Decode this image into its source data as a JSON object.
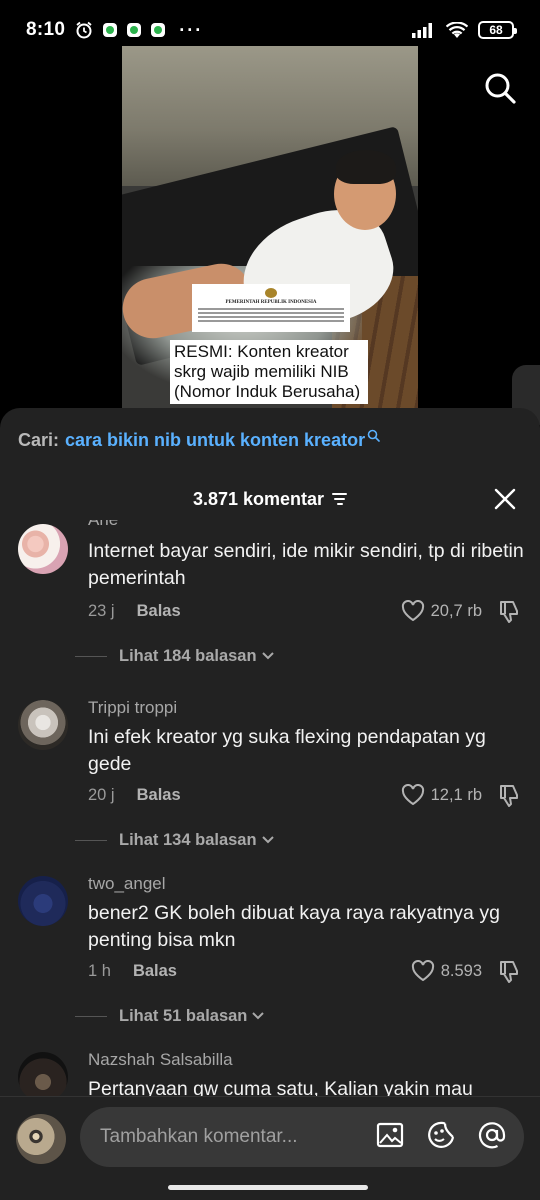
{
  "status_bar": {
    "time": "8:10",
    "battery": "68",
    "more": "···"
  },
  "video": {
    "doc_title": "PEMERINTAH REPUBLIK INDONESIA",
    "caption": "RESMI: Konten kreator skrg wajib memiliki NIB (Nomor Induk Berusaha)"
  },
  "search_suggestion": {
    "label": "Cari:",
    "query": "cara bikin nib untuk konten kreator"
  },
  "sheet": {
    "title": "3.871 komentar"
  },
  "comments": [
    {
      "user": "Arie",
      "text": "Internet bayar sendiri, ide mikir sendiri, tp di ribetin pemerintah",
      "time": "23 j",
      "reply_label": "Balas",
      "likes": "20,7 rb",
      "replies": "Lihat 184 balasan"
    },
    {
      "user": "Trippi troppi",
      "text": "Ini efek kreator yg suka flexing pendapatan yg gede",
      "time": "20 j",
      "reply_label": "Balas",
      "likes": "12,1 rb",
      "replies": "Lihat 134 balasan"
    },
    {
      "user": "two_angel",
      "text": "bener2 GK boleh dibuat kaya raya rakyatnya yg penting bisa mkn",
      "time": "1 h",
      "reply_label": "Balas",
      "likes": "8.593",
      "replies": "Lihat 51 balasan"
    },
    {
      "user": "Nazshah Salsabilla",
      "text": "Pertanyaan gw cuma satu, Kalian yakin mau"
    }
  ],
  "composer": {
    "placeholder": "Tambahkan komentar..."
  },
  "colors": {
    "accent_link": "#5ab1ff",
    "sheet_bg": "#222222"
  }
}
